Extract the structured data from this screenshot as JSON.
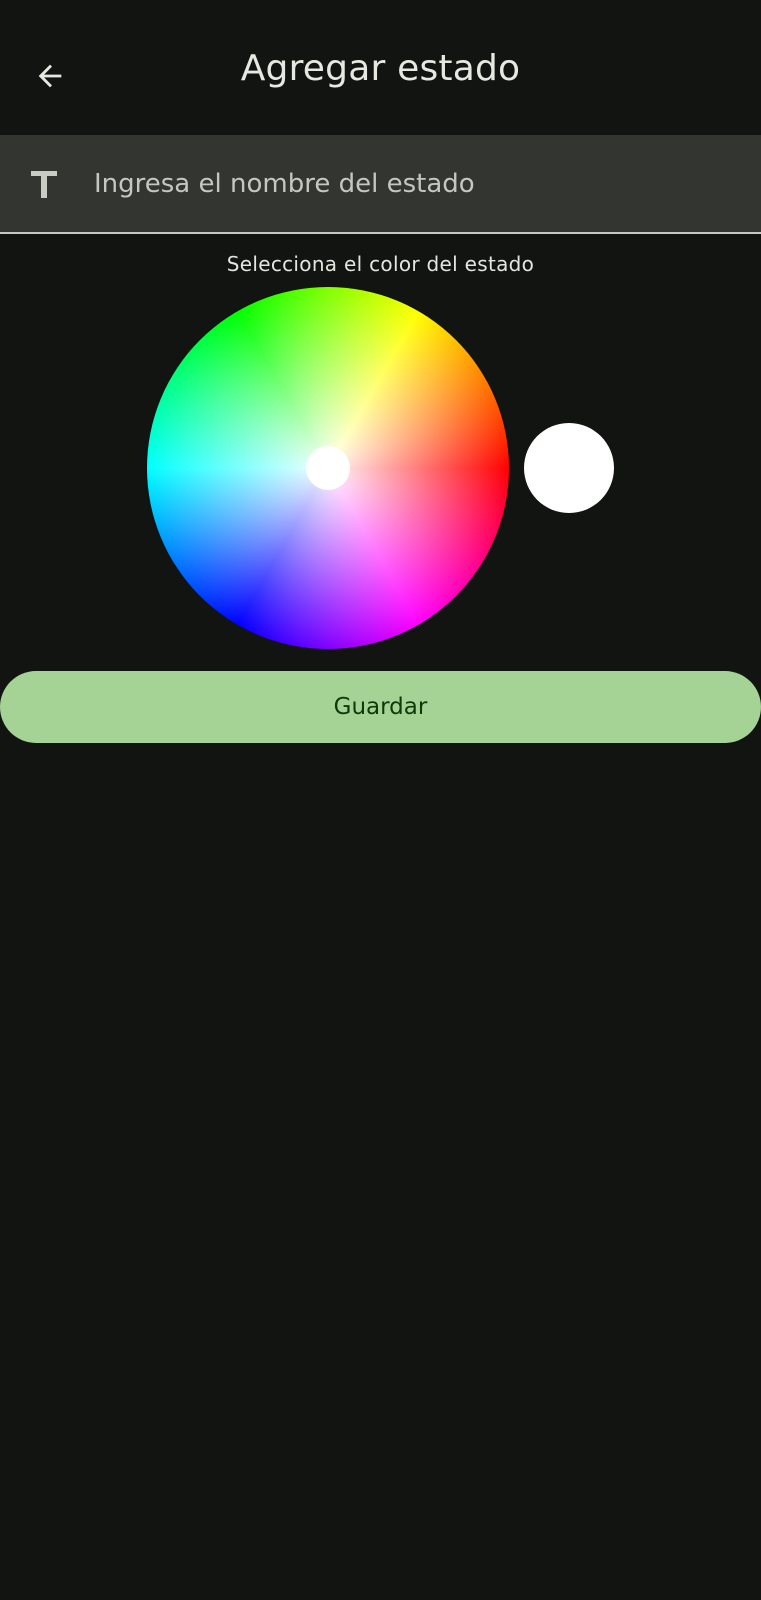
{
  "header": {
    "title": "Agregar estado",
    "back_icon": "arrow-left-icon"
  },
  "name_field": {
    "icon": "text-format-icon",
    "value": "",
    "placeholder": "Ingresa el nombre del estado"
  },
  "color_picker": {
    "label": "Selecciona el color del estado",
    "selected_color": "#ffffff"
  },
  "actions": {
    "save_label": "Guardar"
  },
  "colors": {
    "background": "#121411",
    "field_background": "#333530",
    "primary_button": "#a5d396",
    "primary_button_text": "#0f3a07"
  }
}
